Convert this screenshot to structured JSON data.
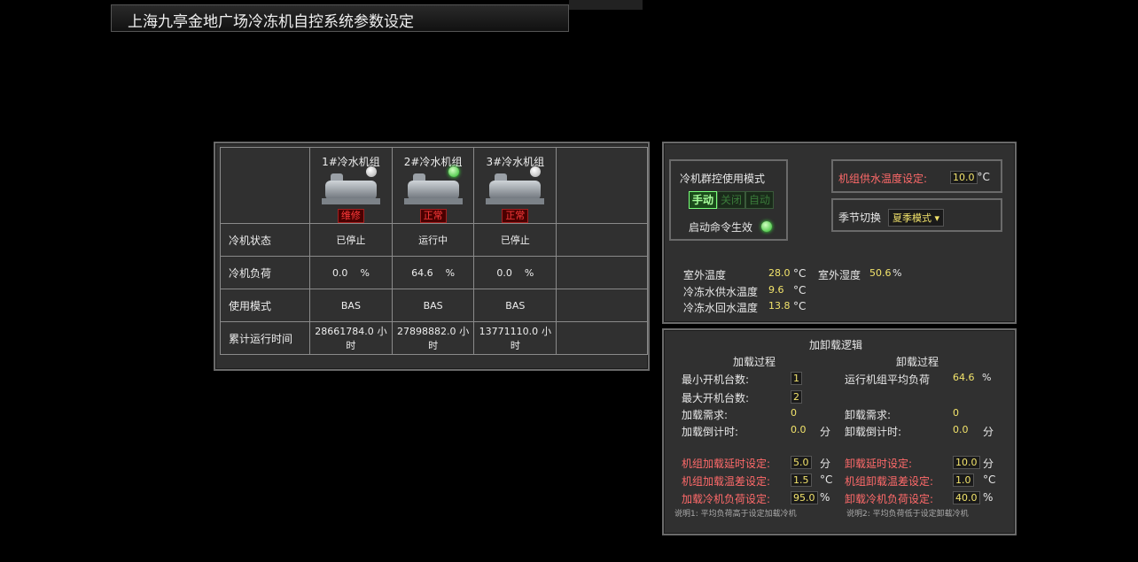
{
  "title": "上海九亭金地广场冷冻机自控系统参数设定",
  "chillers": {
    "headers": [
      "1#冷水机组",
      "2#冷水机组",
      "3#冷水机组"
    ],
    "badges": [
      "维修",
      "正常",
      "正常"
    ],
    "row_labels": {
      "status": "冷机状态",
      "load": "冷机负荷",
      "mode": "使用模式",
      "runtime": "累计运行时间"
    },
    "status": [
      "已停止",
      "运行中",
      "已停止"
    ],
    "load": [
      "0.0",
      "64.6",
      "0.0"
    ],
    "load_unit": "%",
    "mode": [
      "BAS",
      "BAS",
      "BAS"
    ],
    "runtime": [
      "28661784.0",
      "27898882.0",
      "13771110.0"
    ],
    "runtime_unit": "小时"
  },
  "control": {
    "group_mode_label": "冷机群控使用模式",
    "buttons": {
      "manual": "手动",
      "off": "关闭",
      "auto": "自动"
    },
    "start_cmd_label": "启动命令生效",
    "supply_temp_label": "机组供水温度设定:",
    "supply_temp_value": "10.0",
    "supply_temp_unit": "°C",
    "season_label": "季节切换",
    "season_value": "夏季模式",
    "outdoor_temp_label": "室外温度",
    "outdoor_temp_value": "28.0",
    "outdoor_temp_unit": "°C",
    "outdoor_hum_label": "室外湿度",
    "outdoor_hum_value": "50.6",
    "outdoor_hum_unit": "%",
    "chw_supply_label": "冷冻水供水温度",
    "chw_supply_value": "9.6",
    "chw_supply_unit": "°C",
    "chw_return_label": "冷冻水回水温度",
    "chw_return_value": "13.8",
    "chw_return_unit": "°C"
  },
  "load_logic": {
    "title": "加卸载逻辑",
    "load_title": "加载过程",
    "unload_title": "卸载过程",
    "min_units_label": "最小开机台数:",
    "min_units_value": "1",
    "max_units_label": "最大开机台数:",
    "max_units_value": "2",
    "avg_load_label": "运行机组平均负荷",
    "avg_load_value": "64.6",
    "avg_load_unit": "%",
    "load_demand_label": "加载需求:",
    "load_demand_value": "0",
    "unload_demand_label": "卸载需求:",
    "unload_demand_value": "0",
    "load_countdown_label": "加载倒计时:",
    "load_countdown_value": "0.0",
    "unload_countdown_label": "卸载倒计时:",
    "unload_countdown_value": "0.0",
    "minute_unit": "分",
    "load_delay_label": "机组加载延时设定:",
    "load_delay_value": "5.0",
    "unload_delay_label": "卸载延时设定:",
    "unload_delay_value": "10.0",
    "load_tdiff_label": "机组加载温差设定:",
    "load_tdiff_value": "1.5",
    "unload_tdiff_label": "机组卸载温差设定:",
    "unload_tdiff_value": "1.0",
    "temp_unit": "°C",
    "load_pct_label": "加载冷机负荷设定:",
    "load_pct_value": "95.0",
    "unload_pct_label": "卸载冷机负荷设定:",
    "unload_pct_value": "40.0",
    "pct_unit": "%",
    "note1": "说明1: 平均负荷高于设定加载冷机",
    "note2": "说明2: 平均负荷低于设定卸载冷机"
  }
}
